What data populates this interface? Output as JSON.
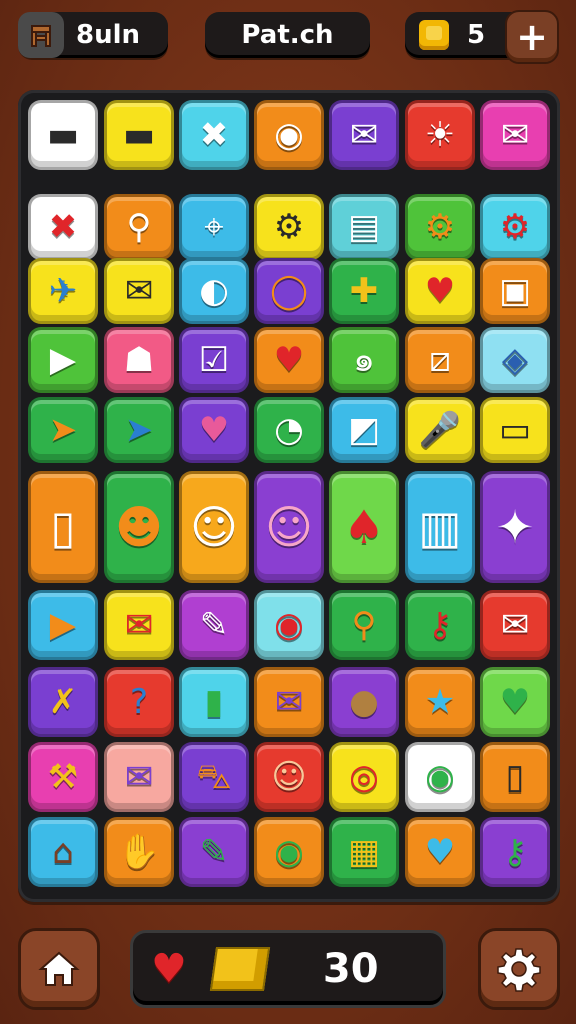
{
  "header": {
    "level_label": "8uln",
    "title": "Pat.ch",
    "coins": "5",
    "add_button_label": "+"
  },
  "board": {
    "tiles": [
      {
        "id": "r1c1",
        "color": "#ffffff",
        "icon": "flag-icon",
        "glyph": "▬",
        "dark": true
      },
      {
        "id": "r1c2",
        "color": "#f7e21c",
        "icon": "flag-icon",
        "glyph": "▬",
        "dark": true
      },
      {
        "id": "r1c3",
        "color": "#4fd3ea",
        "icon": "x-mark-icon",
        "glyph": "✖"
      },
      {
        "id": "r1c4",
        "color": "#f28c1a",
        "icon": "swirl-ball-icon",
        "glyph": "◉"
      },
      {
        "id": "r1c5",
        "color": "#7a3fd1",
        "icon": "envelope-icon",
        "glyph": "✉"
      },
      {
        "id": "r1c6",
        "color": "#e63a2e",
        "icon": "sun-face-icon",
        "glyph": "☀"
      },
      {
        "id": "r1c7",
        "color": "#e83fb0",
        "icon": "envelope-icon",
        "glyph": "✉"
      },
      {
        "id": "r2c1",
        "color": "#ffffff",
        "icon": "x-mark-icon",
        "glyph": "✖",
        "fg": "#e0252a"
      },
      {
        "id": "r2c2",
        "color": "#f28c1a",
        "icon": "magnifier-icon",
        "glyph": "⚲"
      },
      {
        "id": "r2c3",
        "color": "#3dbbe8",
        "icon": "map-pin-icon",
        "glyph": "⌖"
      },
      {
        "id": "r2c4",
        "color": "#f7e21c",
        "icon": "gears-icon",
        "glyph": "⚙",
        "dark": true
      },
      {
        "id": "r2c5",
        "color": "#5fd0d8",
        "icon": "book-icon",
        "glyph": "▤"
      },
      {
        "id": "r2c6",
        "color": "#4fc33a",
        "icon": "gear-icon",
        "glyph": "⚙",
        "fg": "#f28c1a"
      },
      {
        "id": "r2c7",
        "color": "#4fd3ea",
        "icon": "gear-icon",
        "glyph": "⚙",
        "fg": "#e0252a"
      },
      {
        "id": "r3c1",
        "color": "#f7e21c",
        "icon": "plane-icon",
        "glyph": "✈",
        "fg": "#2a7fd0"
      },
      {
        "id": "r3c2",
        "color": "#f7e21c",
        "icon": "envelope-icon",
        "glyph": "✉",
        "dark": true
      },
      {
        "id": "r3c3",
        "color": "#3dbbe8",
        "icon": "fish-icon",
        "glyph": "◐"
      },
      {
        "id": "r3c4",
        "color": "#7a3fd1",
        "icon": "ring-icon",
        "glyph": "◯",
        "fg": "#f28c1a"
      },
      {
        "id": "r3c5",
        "color": "#2fb24a",
        "icon": "cross-icon",
        "glyph": "✚",
        "fg": "#f2c21a"
      },
      {
        "id": "r3c6",
        "color": "#f7e21c",
        "icon": "heart-icon",
        "glyph": "♥",
        "fg": "#e0252a"
      },
      {
        "id": "r3c7",
        "color": "#f28c1a",
        "icon": "radio-icon",
        "glyph": "▣"
      },
      {
        "id": "r4c1",
        "color": "#4fc33a",
        "icon": "play-icon",
        "glyph": "▶"
      },
      {
        "id": "r4c2",
        "color": "#f25a86",
        "icon": "monster-icon",
        "glyph": "☗"
      },
      {
        "id": "r4c3",
        "color": "#7a3fd1",
        "icon": "check-box-icon",
        "glyph": "☑"
      },
      {
        "id": "r4c4",
        "color": "#f28c1a",
        "icon": "heart-icon",
        "glyph": "♥",
        "fg": "#e0252a"
      },
      {
        "id": "r4c5",
        "color": "#4fc33a",
        "icon": "snail-icon",
        "glyph": "๑"
      },
      {
        "id": "r4c6",
        "color": "#f28c1a",
        "icon": "card-icon",
        "glyph": "⧄"
      },
      {
        "id": "r4c7",
        "color": "#8fe0f2",
        "icon": "diamond-box-icon",
        "glyph": "◈",
        "fg": "#2a5fb0"
      },
      {
        "id": "r5c1",
        "color": "#2fb24a",
        "icon": "arrow-icon",
        "glyph": "➤",
        "fg": "#f28c1a"
      },
      {
        "id": "r5c2",
        "color": "#2fb24a",
        "icon": "arrow-icon",
        "glyph": "➤",
        "fg": "#2a7fd0"
      },
      {
        "id": "r5c3",
        "color": "#7a3fd1",
        "icon": "heart-icon",
        "glyph": "♥",
        "fg": "#e85a9a"
      },
      {
        "id": "r5c4",
        "color": "#2fb24a",
        "icon": "swirl-icon",
        "glyph": "◔"
      },
      {
        "id": "r5c5",
        "color": "#3dbbe8",
        "icon": "arrow-box-icon",
        "glyph": "◩"
      },
      {
        "id": "r5c6",
        "color": "#f7e21c",
        "icon": "microphone-icon",
        "glyph": "🎤"
      },
      {
        "id": "r5c7",
        "color": "#f7e21c",
        "icon": "window-icon",
        "glyph": "▭",
        "dark": true
      },
      {
        "id": "r6c1",
        "color": "#f28c1a",
        "icon": "phone-icon",
        "glyph": "▯",
        "big": true
      },
      {
        "id": "r6c2",
        "color": "#2fb24a",
        "icon": "tiki-mask-icon",
        "glyph": "☻",
        "big": true,
        "fg": "#f28c1a"
      },
      {
        "id": "r6c3",
        "color": "#f7a81c",
        "icon": "cat-face-icon",
        "glyph": "☺",
        "big": true
      },
      {
        "id": "r6c4",
        "color": "#8a3fd1",
        "icon": "cat-figure-icon",
        "glyph": "☺",
        "big": true,
        "fg": "#f7a6c8"
      },
      {
        "id": "r6c5",
        "color": "#6fd84a",
        "icon": "lollipop-icon",
        "glyph": "♠",
        "big": true,
        "fg": "#e0252a"
      },
      {
        "id": "r6c6",
        "color": "#3dbbe8",
        "icon": "machine-icon",
        "glyph": "▥",
        "big": true
      },
      {
        "id": "r6c7",
        "color": "#8a3fd1",
        "icon": "leaf-sparkle-icon",
        "glyph": "✦",
        "big": true
      },
      {
        "id": "r7c1",
        "color": "#3dbbe8",
        "icon": "flag-icon",
        "glyph": "▶",
        "fg": "#f28c1a"
      },
      {
        "id": "r7c2",
        "color": "#f7e21c",
        "icon": "card-icon",
        "glyph": "✉",
        "fg": "#e0252a"
      },
      {
        "id": "r7c3",
        "color": "#b03fd1",
        "icon": "bone-icon",
        "glyph": "✎"
      },
      {
        "id": "r7c4",
        "color": "#7fe0ea",
        "icon": "swirl-ball-icon",
        "glyph": "◉",
        "fg": "#e0252a"
      },
      {
        "id": "r7c5",
        "color": "#2fb24a",
        "icon": "magnifier-icon",
        "glyph": "⚲",
        "fg": "#f28c1a"
      },
      {
        "id": "r7c6",
        "color": "#2fb24a",
        "icon": "key-icon",
        "glyph": "⚷",
        "fg": "#e0252a"
      },
      {
        "id": "r7c7",
        "color": "#e63a2e",
        "icon": "envelope-icon",
        "glyph": "✉"
      },
      {
        "id": "r8c1",
        "color": "#7a3fd1",
        "icon": "wrench-icon",
        "glyph": "✗",
        "fg": "#f2c21a"
      },
      {
        "id": "r8c2",
        "color": "#e63a2e",
        "icon": "hook-icon",
        "glyph": "?",
        "fg": "#2a7fd0"
      },
      {
        "id": "r8c3",
        "color": "#4fd3ea",
        "icon": "battery-icon",
        "glyph": "▮",
        "fg": "#2fb24a"
      },
      {
        "id": "r8c4",
        "color": "#f28c1a",
        "icon": "envelope-icon",
        "glyph": "✉",
        "fg": "#7a3fd1"
      },
      {
        "id": "r8c5",
        "color": "#8a3fd1",
        "icon": "face-icon",
        "glyph": "●",
        "fg": "#b08040"
      },
      {
        "id": "r8c6",
        "color": "#f28c1a",
        "icon": "star-icon",
        "glyph": "★",
        "fg": "#3dbbe8"
      },
      {
        "id": "r8c7",
        "color": "#6fd84a",
        "icon": "heart-icon",
        "glyph": "♥",
        "fg": "#2fb24a"
      },
      {
        "id": "r9c1",
        "color": "#e83fb0",
        "icon": "catapult-icon",
        "glyph": "⚒",
        "fg": "#f2c21a"
      },
      {
        "id": "r9c2",
        "color": "#f7a8a0",
        "icon": "envelope-icon",
        "glyph": "✉",
        "fg": "#7a3fd1"
      },
      {
        "id": "r9c3",
        "color": "#7a3fd1",
        "icon": "car-icon",
        "glyph": "⛍",
        "fg": "#f28c1a"
      },
      {
        "id": "r9c4",
        "color": "#e63a2e",
        "icon": "fox-icon",
        "glyph": "☺",
        "fg": "#f7c89a"
      },
      {
        "id": "r9c5",
        "color": "#f7e21c",
        "icon": "target-icon",
        "glyph": "◎",
        "fg": "#e0252a"
      },
      {
        "id": "r9c6",
        "color": "#ffffff",
        "icon": "swirl-ball-icon",
        "glyph": "◉",
        "fg": "#2fb24a"
      },
      {
        "id": "r9c7",
        "color": "#f28c1a",
        "icon": "tablet-icon",
        "glyph": "▯",
        "fg": "#2a2a2a"
      },
      {
        "id": "r10c1",
        "color": "#3dbbe8",
        "icon": "radio-icon",
        "glyph": "⌂",
        "fg": "#7a3f25"
      },
      {
        "id": "r10c2",
        "color": "#f28c1a",
        "icon": "hand-icon",
        "glyph": "✋",
        "fg": "#f2c21a"
      },
      {
        "id": "r10c3",
        "color": "#8a3fd1",
        "icon": "pen-icon",
        "glyph": "✎",
        "fg": "#2fb24a"
      },
      {
        "id": "r10c4",
        "color": "#f28c1a",
        "icon": "swirl-ball-icon",
        "glyph": "◉",
        "fg": "#2fb24a"
      },
      {
        "id": "r10c5",
        "color": "#2fb24a",
        "icon": "cube-icon",
        "glyph": "▦",
        "fg": "#f2c21a"
      },
      {
        "id": "r10c6",
        "color": "#f28c1a",
        "icon": "heart-icon",
        "glyph": "♥",
        "fg": "#3dbbe8"
      },
      {
        "id": "r10c7",
        "color": "#8a3fd1",
        "icon": "key-icon",
        "glyph": "⚷",
        "fg": "#2fb24a"
      }
    ]
  },
  "footer": {
    "home_icon": "home-icon",
    "heart_icon": "heart-arrow-icon",
    "cube_icon": "cube-icon",
    "score": "30",
    "settings_icon": "gear-icon"
  }
}
